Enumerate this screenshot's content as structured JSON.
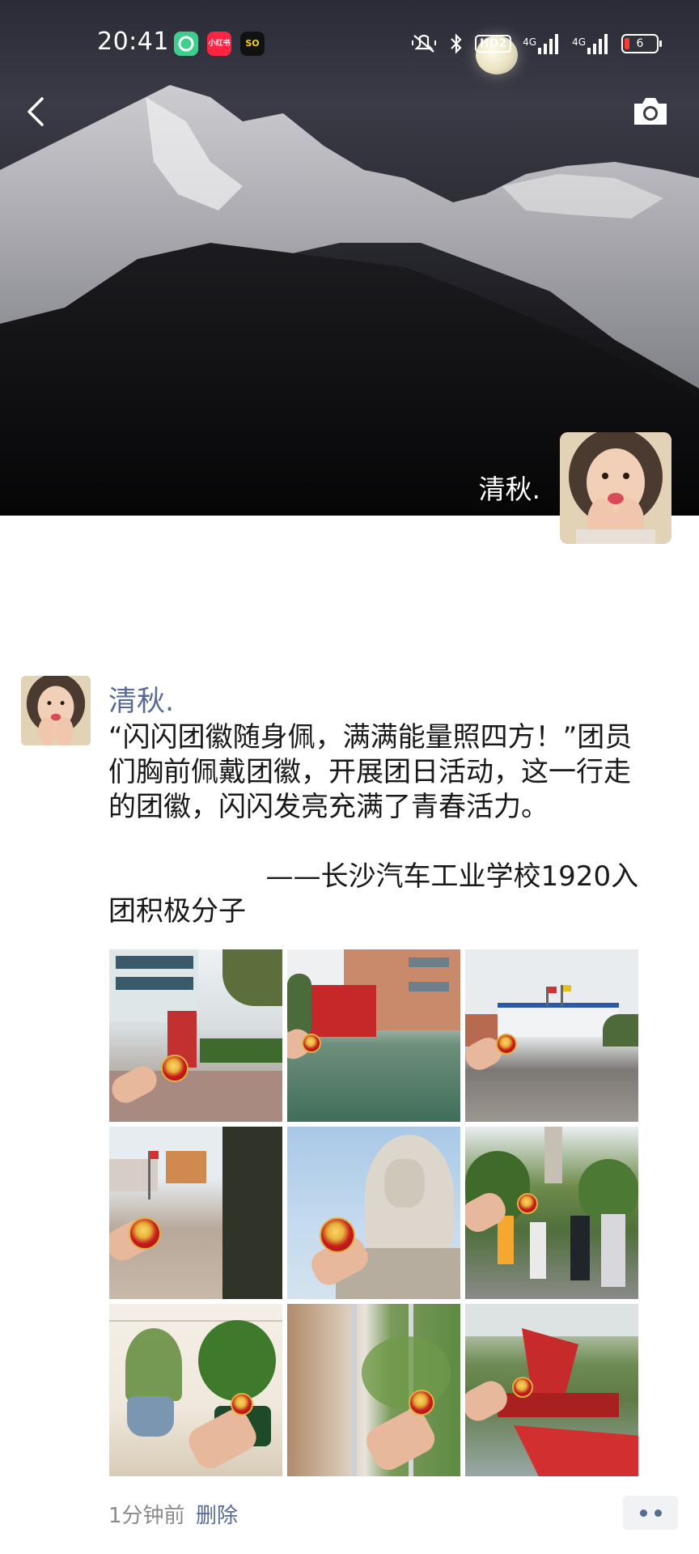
{
  "status_bar": {
    "time": "20:41",
    "apps": [
      {
        "name": "green-app",
        "label": "",
        "color": "#3ecf8e"
      },
      {
        "name": "xiaohongshu-app",
        "label": "小红书",
        "color": "#ff2442"
      },
      {
        "name": "soul-app",
        "label": "SO",
        "color": "#111111"
      }
    ],
    "network_hd": "HD2",
    "network_1": "4G",
    "network_2": "4G",
    "battery": "6"
  },
  "cover": {
    "name": "清秋.",
    "back_icon": "chevron-left-icon",
    "camera_icon": "camera-icon"
  },
  "post": {
    "author": "清秋.",
    "text": "“闪闪团徽随身佩，满满能量照四方！”团员们胸前佩戴团徽，开展团日活动，这一行走的团徽，闪闪发亮充满了青春活力。\n\n                  ——长沙汽车工业学校1920入团积极分子",
    "time": "1分钟前",
    "delete_label": "删除",
    "photos": [
      {
        "scene": "campus-building-stairs"
      },
      {
        "scene": "red-sculpture-court"
      },
      {
        "scene": "school-building-flags"
      },
      {
        "scene": "parade-ground"
      },
      {
        "scene": "stone-statue"
      },
      {
        "scene": "pagoda-crowd"
      },
      {
        "scene": "potted-plants"
      },
      {
        "scene": "window-greenery"
      },
      {
        "scene": "red-monument"
      }
    ]
  },
  "colors": {
    "link": "#576b95",
    "text": "#191919",
    "meta": "#8a8a8a"
  }
}
